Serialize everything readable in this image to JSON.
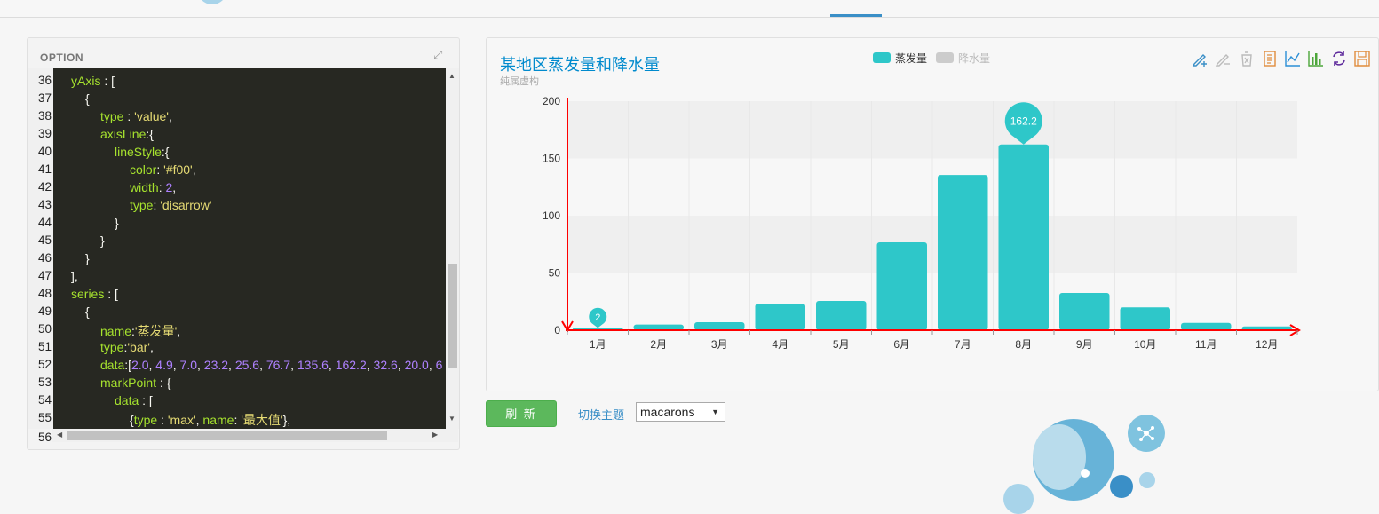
{
  "option_panel": {
    "title": "OPTION",
    "line_numbers": [
      "36",
      "37",
      "38",
      "39",
      "40",
      "41",
      "42",
      "43",
      "44",
      "45",
      "46",
      "47",
      "48",
      "49",
      "50",
      "51",
      "52",
      "53",
      "54",
      "55"
    ],
    "last_line_number": "56"
  },
  "code": {
    "l36_key": "yAxis",
    "l36_rest": " : [",
    "l37": "{",
    "l38_key": "type",
    "l38_mid": " : ",
    "l38_val": "'value'",
    "l38_end": ",",
    "l39_key": "axisLine",
    "l39_rest": ":{",
    "l40_key": "lineStyle",
    "l40_rest": ":{",
    "l41_key": "color",
    "l41_mid": ": ",
    "l41_val": "'#f00'",
    "l41_end": ",",
    "l42_key": "width",
    "l42_mid": ": ",
    "l42_val": "2",
    "l42_end": ",",
    "l43_key": "type",
    "l43_mid": ": ",
    "l43_val": "'disarrow'",
    "l44": "}",
    "l45": "}",
    "l46": "}",
    "l47": "],",
    "l48_key": "series",
    "l48_rest": " : [",
    "l49": "{",
    "l50_key": "name",
    "l50_mid": ":",
    "l50_val": "'蒸发量'",
    "l50_end": ",",
    "l51_key": "type",
    "l51_mid": ":",
    "l51_val": "'bar'",
    "l51_end": ",",
    "l52_key": "data",
    "l52_mid": ":[",
    "l52_vals": [
      "2.0",
      "4.9",
      "7.0",
      "23.2",
      "25.6",
      "76.7",
      "135.6",
      "162.2",
      "32.6",
      "20.0",
      "6"
    ],
    "l53_key": "markPoint",
    "l53_rest": " : {",
    "l54_key": "data",
    "l54_rest": " : [",
    "l55_a": "{",
    "l55_key1": "type",
    "l55_mid1": " : ",
    "l55_val1": "'max'",
    "l55_sep": ", ",
    "l55_key2": "name",
    "l55_mid2": ": ",
    "l55_val2": "'最大值'",
    "l55_end": "},"
  },
  "chart_data": {
    "type": "bar",
    "title": "某地区蒸发量和降水量",
    "subtitle": "纯属虚构",
    "categories": [
      "1月",
      "2月",
      "3月",
      "4月",
      "5月",
      "6月",
      "7月",
      "8月",
      "9月",
      "10月",
      "11月",
      "12月"
    ],
    "series": [
      {
        "name": "蒸发量",
        "values": [
          2.0,
          4.9,
          7.0,
          23.2,
          25.6,
          76.7,
          135.6,
          162.2,
          32.6,
          20.0,
          6.4,
          3.3
        ],
        "color": "#2ec7c9"
      },
      {
        "name": "降水量",
        "values": [],
        "color": "#cccccc",
        "hidden": true
      }
    ],
    "yticks": [
      "0",
      "50",
      "100",
      "150",
      "200"
    ],
    "ylim": [
      0,
      200
    ],
    "mark_points": [
      {
        "label": "162.2",
        "category": "8月",
        "value": 162.2
      },
      {
        "label": "2",
        "category": "1月",
        "value": 2.0
      }
    ],
    "axis_color": "#ff0000",
    "grid": true,
    "legend_position": "top-center"
  },
  "toolbox": {
    "icons": [
      "mark-icon",
      "mark-undo-icon",
      "mark-clear-icon",
      "data-view-icon",
      "line-icon",
      "bar-icon",
      "restore-icon",
      "save-image-icon"
    ]
  },
  "controls": {
    "refresh_label": "刷 新",
    "theme_label": "切换主题",
    "theme_value": "macarons"
  }
}
